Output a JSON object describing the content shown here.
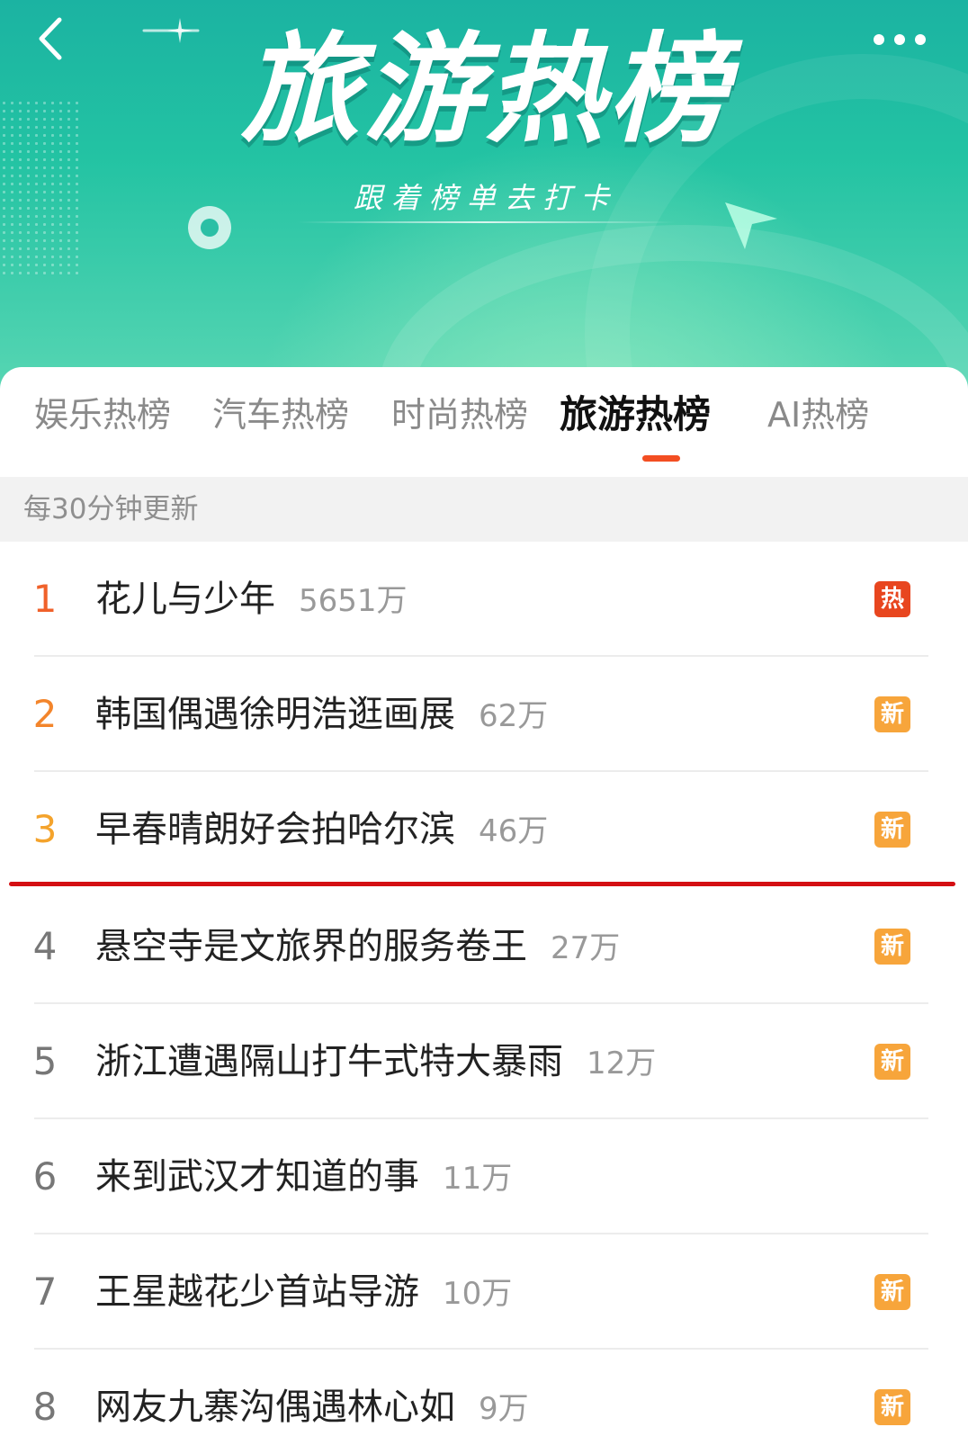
{
  "banner": {
    "title": "旅游热榜",
    "subtitle": "跟着榜单去打卡"
  },
  "tabs": [
    {
      "label": "娱乐热榜"
    },
    {
      "label": "汽车热榜"
    },
    {
      "label": "时尚热榜"
    },
    {
      "label": "旅游热榜",
      "active": true
    },
    {
      "label": "AI热榜"
    }
  ],
  "notice": "每30分钟更新",
  "colors": {
    "accent": "#f34e22",
    "rank1": "#f0612a",
    "rank2": "#f3852b",
    "rank3": "#f4a32c",
    "badge_hot": "#e8461f",
    "badge_new": "#f7a53b",
    "highlight_line": "#d40f12"
  },
  "list": [
    {
      "rank": "1",
      "title": "花儿与少年",
      "count": "5651万",
      "badge": "热"
    },
    {
      "rank": "2",
      "title": "韩国偶遇徐明浩逛画展",
      "count": "62万",
      "badge": "新"
    },
    {
      "rank": "3",
      "title": "早春晴朗好会拍哈尔滨",
      "count": "46万",
      "badge": "新"
    },
    {
      "rank": "4",
      "title": "悬空寺是文旅界的服务卷王",
      "count": "27万",
      "badge": "新"
    },
    {
      "rank": "5",
      "title": "浙江遭遇隔山打牛式特大暴雨",
      "count": "12万",
      "badge": "新"
    },
    {
      "rank": "6",
      "title": "来到武汉才知道的事",
      "count": "11万",
      "badge": ""
    },
    {
      "rank": "7",
      "title": "王星越花少首站导游",
      "count": "10万",
      "badge": "新"
    },
    {
      "rank": "8",
      "title": "网友九寨沟偶遇林心如",
      "count": "9万",
      "badge": "新"
    }
  ]
}
